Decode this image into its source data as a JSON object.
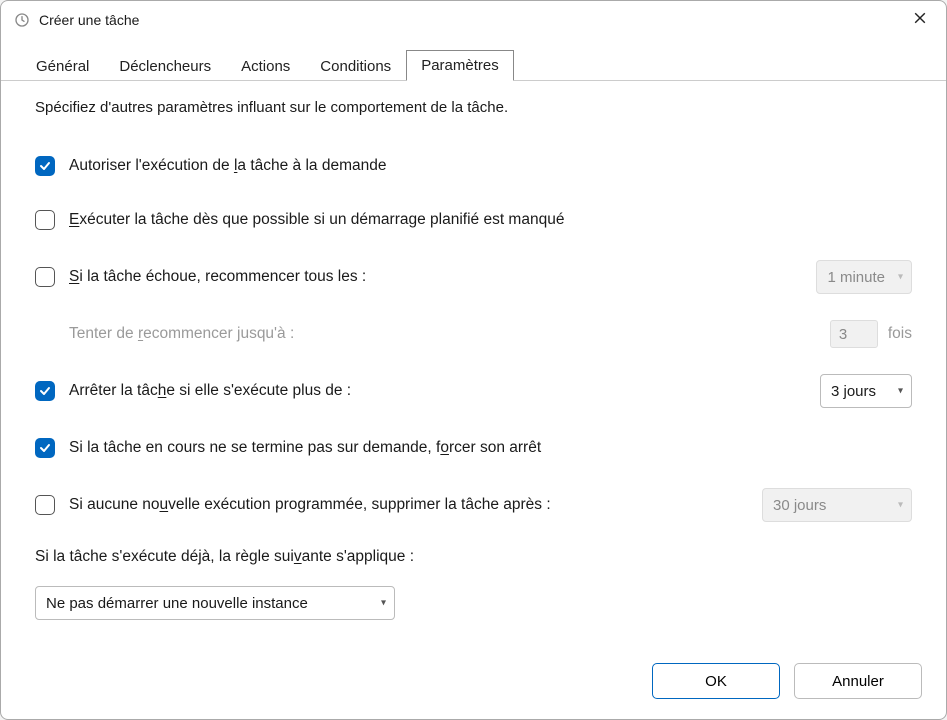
{
  "window": {
    "title": "Créer une tâche",
    "close_label": "Fermer"
  },
  "tabs": {
    "general": "Général",
    "triggers": "Déclencheurs",
    "actions": "Actions",
    "conditions": "Conditions",
    "settings": "Paramètres",
    "active": "settings"
  },
  "settings": {
    "description": "Spécifiez d'autres paramètres influant sur le comportement de la tâche.",
    "allow_demand": {
      "checked": true,
      "label_before": "Autoriser l'exécution de ",
      "label_under": "l",
      "label_after": "a tâche à la demande"
    },
    "run_asap": {
      "checked": false,
      "label_before": "",
      "label_under": "E",
      "label_after": "xécuter la tâche dès que possible si un démarrage planifié est manqué"
    },
    "retry": {
      "checked": false,
      "label_before": "",
      "label_under": "S",
      "label_after": "i la tâche échoue, recommencer tous les :",
      "interval_value": "1 minute",
      "attempts_before": "Tenter de ",
      "attempts_under": "r",
      "attempts_after": "ecommencer jusqu'à :",
      "attempts_value": "3",
      "attempts_suffix": "fois"
    },
    "stop_after": {
      "checked": true,
      "label_before": "Arrêter la tâc",
      "label_under": "h",
      "label_after": "e si elle s'exécute plus de :",
      "value": "3 jours"
    },
    "force_stop": {
      "checked": true,
      "label_before": "Si la tâche en cours ne se termine pas sur demande, f",
      "label_under": "o",
      "label_after": "rcer son arrêt"
    },
    "delete_after": {
      "checked": false,
      "label_before": "Si aucune no",
      "label_under": "u",
      "label_after": "velle exécution programmée, supprimer la tâche après :",
      "value": "30 jours"
    },
    "rule_before": "Si la tâche s'exécute déjà, la règle sui",
    "rule_under": "v",
    "rule_after": "ante s'applique :",
    "rule_value": "Ne pas démarrer une nouvelle instance"
  },
  "buttons": {
    "ok": "OK",
    "cancel": "Annuler"
  }
}
